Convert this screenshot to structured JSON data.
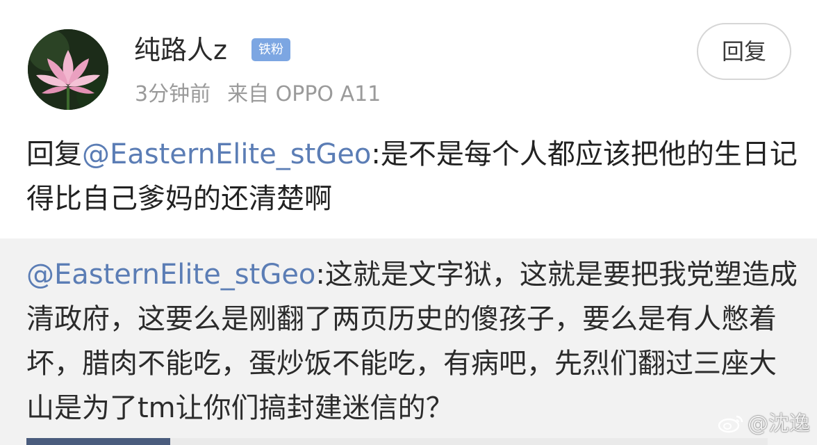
{
  "post": {
    "user": {
      "name": "纯路人z",
      "badge": "铁粉",
      "avatar": "lotus-flower-avatar"
    },
    "time": "3分钟前",
    "source": "来自 OPPO A11",
    "reply_label": "回复",
    "comment": {
      "prefix": "回复",
      "mention": "@EasternElite_stGeo",
      "text": ":是不是每个人都应该把他的生日记得比自己爹妈的还清楚啊"
    }
  },
  "quoted": {
    "mention": "@EasternElite_stGeo",
    "text": ":这就是文字狱，这就是要把我党塑造成清政府，这要么是刚翻了两页历史的傻孩子，要么是有人憋着坏，腊肉不能吃，蛋炒饭不能吃，有病吧，先烈们翻过三座大山是为了tm让你们搞封建迷信的？"
  },
  "watermark": {
    "icon": "weibo-icon",
    "text": "@沈逸"
  },
  "colors": {
    "mention": "#5b7db5",
    "badge": "#7ca6e2",
    "quote_bg": "#f2f2f2",
    "meta": "#9a9a9a"
  }
}
